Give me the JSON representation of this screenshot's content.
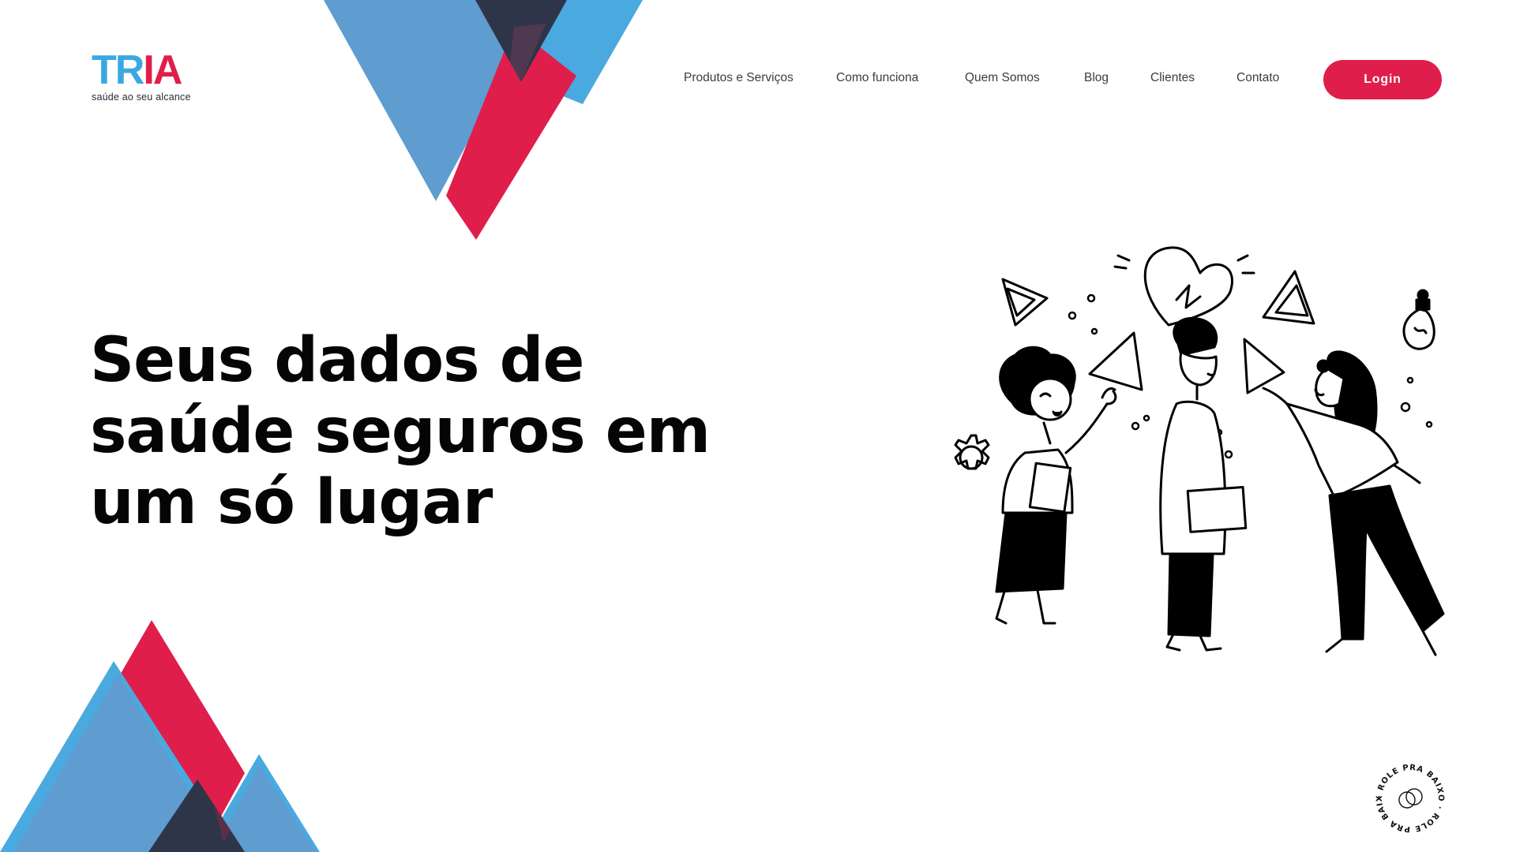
{
  "brand": {
    "logo_part1": "TR",
    "logo_part2": "IA",
    "tagline": "saúde ao seu alcance"
  },
  "nav": {
    "items": [
      {
        "label": "Produtos e Serviços"
      },
      {
        "label": "Como funciona"
      },
      {
        "label": "Quem Somos"
      },
      {
        "label": "Blog"
      },
      {
        "label": "Clientes"
      },
      {
        "label": "Contato"
      }
    ],
    "login_label": "Login"
  },
  "hero": {
    "headline_lines": [
      "Seus dados de",
      "saúde seguros em",
      "um só lugar"
    ]
  },
  "scroll_badge": {
    "text": "· ROLE PRA BAIXO · ROLE PRA BAIXO"
  },
  "colors": {
    "red": "#e01e4b",
    "blue": "#3aa8e0",
    "mid_blue": "#5f9ccf",
    "navy": "#2f3548"
  },
  "icons": [
    "heart-icon",
    "lightbulb-icon",
    "gear-icon",
    "triangle-icon"
  ]
}
